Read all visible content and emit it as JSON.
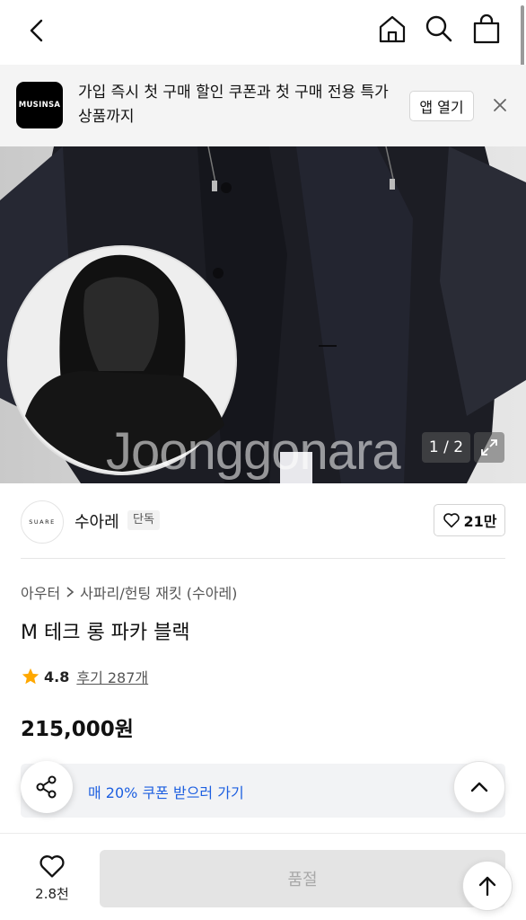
{
  "icons": {
    "back": "chevron-left-icon",
    "home": "home-icon",
    "search": "search-icon",
    "bag": "shopping-bag-icon",
    "close": "close-icon",
    "expand": "expand-icon",
    "like": "heart-icon",
    "star": "star-icon",
    "share": "share-icon",
    "chevron_up": "chevron-up-icon",
    "arrow_up": "arrow-up-icon"
  },
  "banner": {
    "logo_text": "MUSINSA",
    "message": "가입 즉시 첫 구매 할인 쿠폰과 첫 구매 전용 특가 상품까지",
    "open_app_label": "앱 열기"
  },
  "hero": {
    "watermark": "Joonggonara",
    "image_counter": "1 / 2"
  },
  "brand": {
    "logo_text": "SUARE",
    "name": "수아레",
    "tag": "단독",
    "like_count": "21만"
  },
  "product": {
    "breadcrumb": [
      "아우터",
      "사파리/헌팅 재킷 (수아레)"
    ],
    "title": "M 테크 롱 파카 블랙",
    "rating": "4.8",
    "reviews": "후기 287개",
    "price": "215,000원",
    "coupon_text": "매 20% 쿠폰 받으러 가기"
  },
  "bottom": {
    "like_count": "2.8천",
    "sold_out_label": "품절"
  },
  "colors": {
    "accent_blue": "#1d5fe0",
    "star": "#ffa800",
    "banner_bg": "#f4f4f4"
  }
}
